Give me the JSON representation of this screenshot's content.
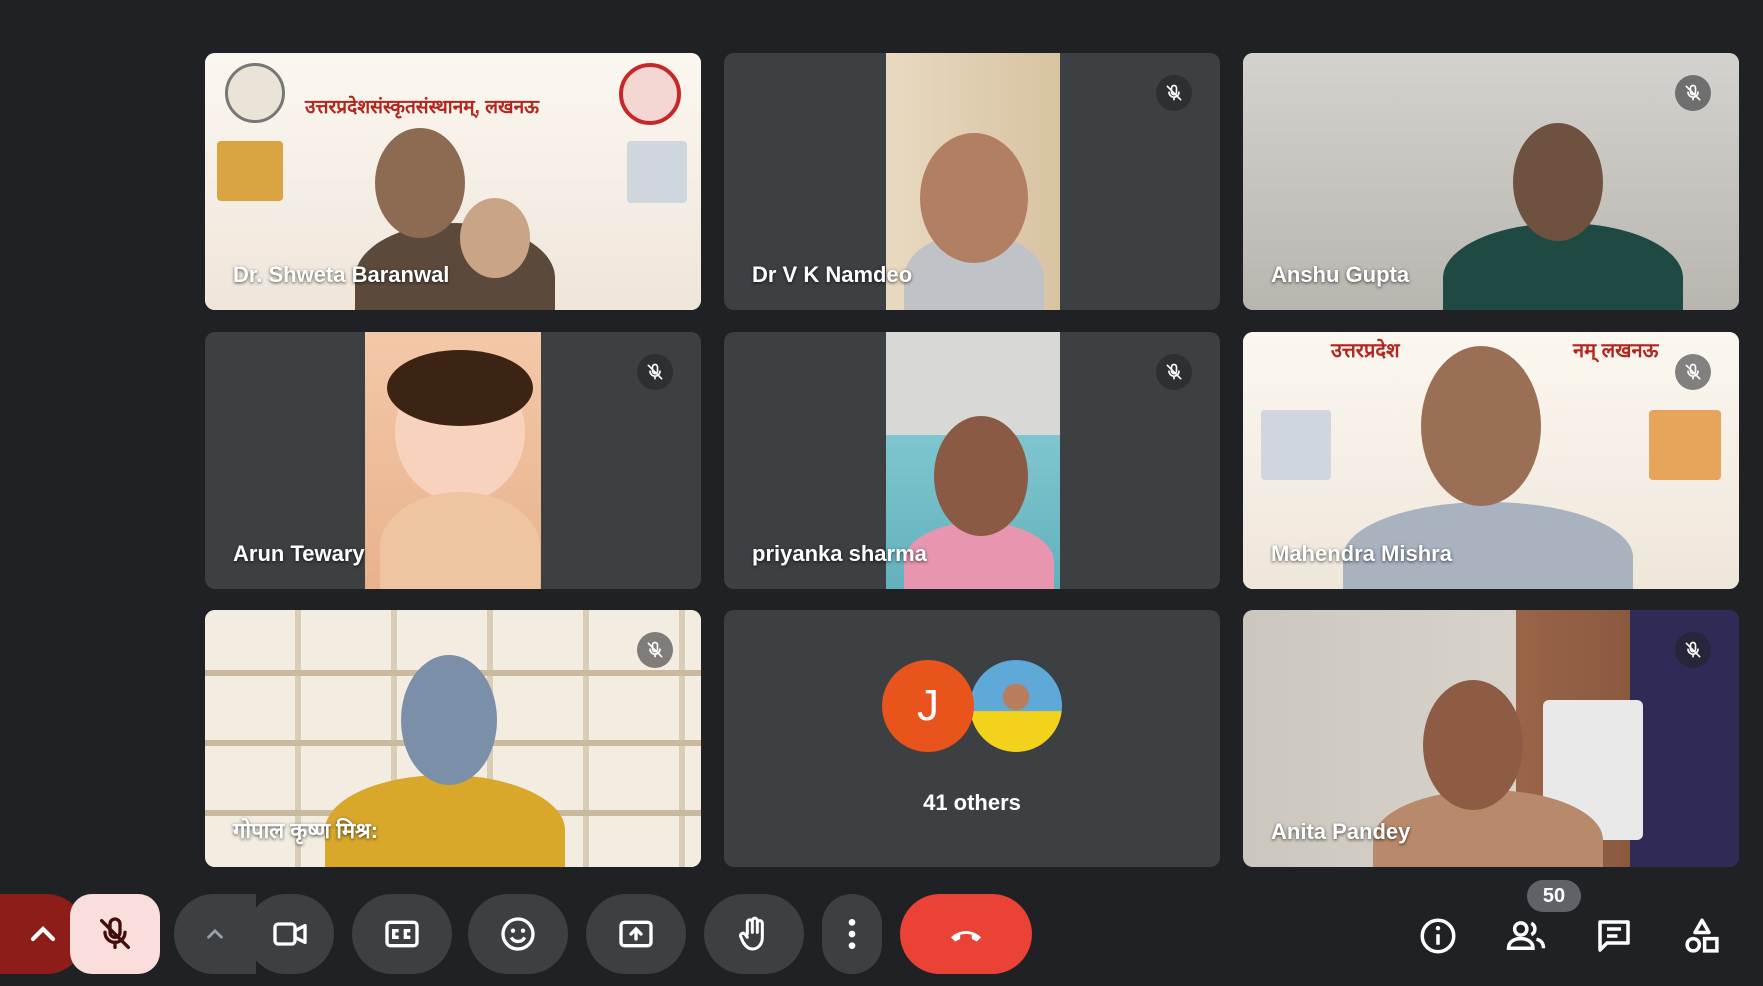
{
  "participants": [
    {
      "name": "Dr. Shweta Baranwal",
      "muted": false
    },
    {
      "name": "Dr V K Namdeo",
      "muted": true
    },
    {
      "name": "Anshu Gupta",
      "muted": true
    },
    {
      "name": "Arun Tewary",
      "muted": true
    },
    {
      "name": "priyanka sharma",
      "muted": true
    },
    {
      "name": "Mahendra Mishra",
      "muted": true
    },
    {
      "name": "गोपाल कृष्ण मिश्र:",
      "muted": true
    },
    {
      "name": "Anita Pandey",
      "muted": true
    }
  ],
  "others": {
    "label": "41 others",
    "avatar_initial": "J",
    "avatar_color": "#e8541c"
  },
  "poster": {
    "title": "उत्तरप्रदेशसंस्कृतसंस्थानम्, लखनऊ",
    "title_short_a": "उत्तरप्रदेश",
    "title_short_b": "नम् लखनऊ"
  },
  "people_count": "50",
  "colors": {
    "background": "#202124",
    "tile": "#3c4043",
    "end_call": "#ea4335",
    "mic_off_bg": "#f9dedc",
    "more_bg": "#8c1d18"
  },
  "icons": [
    "chevron-up-icon",
    "mic-off-icon",
    "video-icon",
    "captions-icon",
    "emoji-icon",
    "present-icon",
    "hand-icon",
    "more-icon",
    "end-call-icon",
    "info-icon",
    "people-icon",
    "chat-icon",
    "activities-icon"
  ]
}
